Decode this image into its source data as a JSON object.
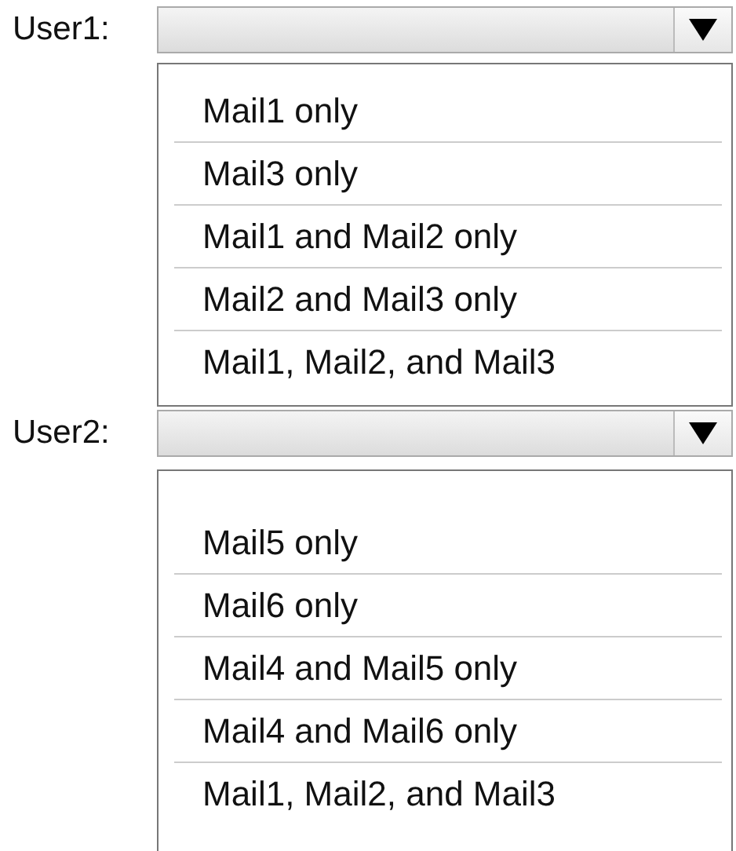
{
  "dropdowns": [
    {
      "label": "User1:",
      "options": [
        "Mail1 only",
        "Mail3 only",
        "Mail1 and Mail2 only",
        "Mail2 and Mail3 only",
        "Mail1, Mail2, and Mail3"
      ]
    },
    {
      "label": "User2:",
      "options": [
        "Mail5 only",
        "Mail6 only",
        "Mail4 and Mail5 only",
        "Mail4 and Mail6 only",
        "Mail1, Mail2, and Mail3"
      ]
    }
  ]
}
